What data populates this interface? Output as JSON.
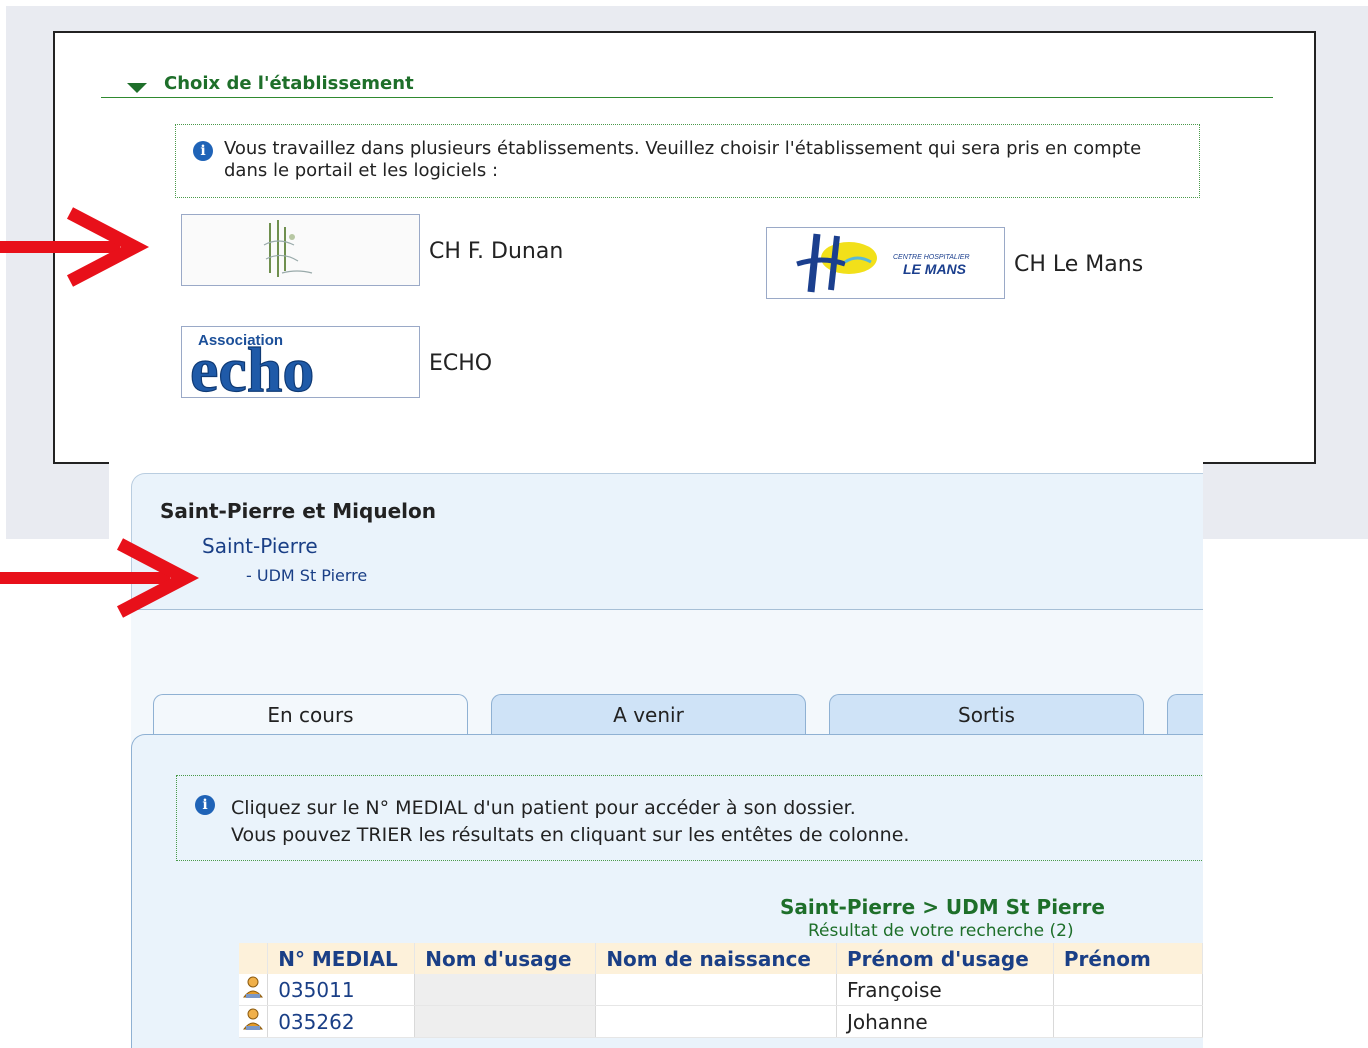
{
  "establishment_choice": {
    "section_title": "Choix de l'établissement",
    "info_line1": "Vous travaillez dans plusieurs établissements. Veuillez choisir l'établissement qui sera pris en compte",
    "info_line2": "dans le portail et les logiciels :",
    "establishments": [
      {
        "name": "CH F. Dunan",
        "logo": "ch-f-dunan-logo"
      },
      {
        "name": "CH Le Mans",
        "logo": "ch-le-mans-logo",
        "logo_small_text": "CENTRE HOSPITALIER",
        "logo_text": "LE MANS"
      },
      {
        "name": "ECHO",
        "logo": "echo-logo",
        "logo_small_text": "Association",
        "logo_text": "echo"
      }
    ]
  },
  "location": {
    "region": "Saint-Pierre et Miquelon",
    "city": "Saint-Pierre",
    "unit": "- UDM St Pierre"
  },
  "tabs": [
    {
      "label": "En cours",
      "active": true
    },
    {
      "label": "A venir",
      "active": false
    },
    {
      "label": "Sortis",
      "active": false
    }
  ],
  "results_info": {
    "line1": "Cliquez sur le N° MEDIAL d'un patient pour accéder à son dossier.",
    "line2": "Vous pouvez TRIER les résultats en cliquant sur les entêtes de colonne."
  },
  "results": {
    "path": "Saint-Pierre > UDM St Pierre",
    "count_label": "Résultat de votre recherche (2)",
    "columns": [
      "N° MEDIAL",
      "Nom d'usage",
      "Nom de naissance",
      "Prénom d'usage",
      "Prénom"
    ],
    "rows": [
      {
        "medial": "035011",
        "nom_usage": "",
        "nom_naissance": "",
        "prenom_usage": "Françoise",
        "prenom": ""
      },
      {
        "medial": "035262",
        "nom_usage": "",
        "nom_naissance": "",
        "prenom_usage": "Johanne",
        "prenom": ""
      }
    ]
  },
  "colors": {
    "annotation_arrow": "#e8101a",
    "section_green": "#1e6f2a",
    "link_blue": "#1a3f86",
    "tab_inactive": "#cfe3f7",
    "panel_bg": "#eaf3fb",
    "table_header_bg": "#fdf1da"
  }
}
